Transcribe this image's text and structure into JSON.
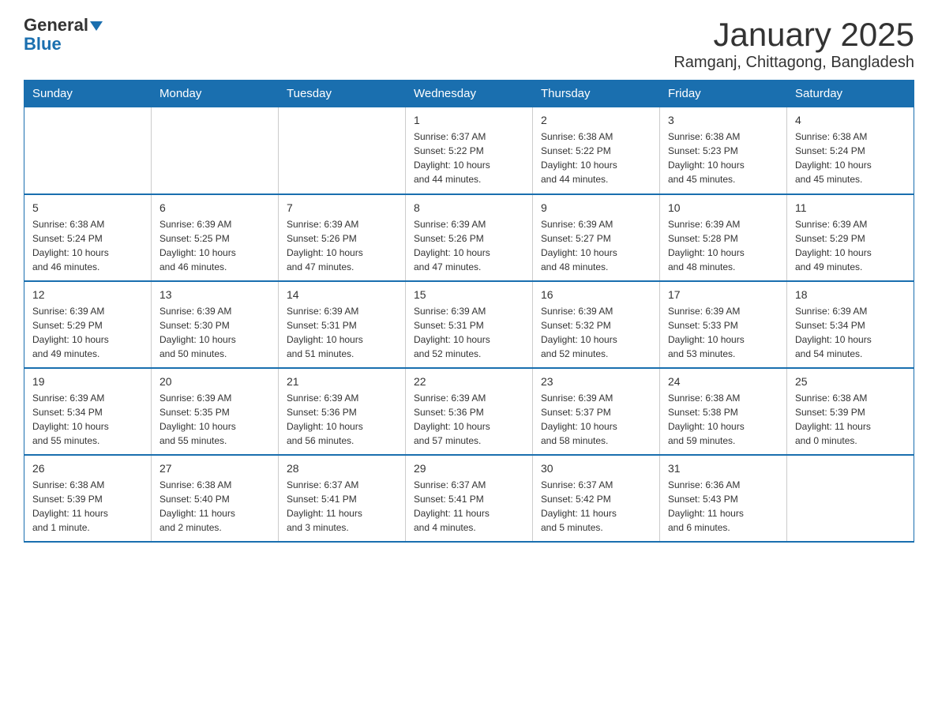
{
  "logo": {
    "line1": "General",
    "line2": "Blue"
  },
  "title": "January 2025",
  "subtitle": "Ramganj, Chittagong, Bangladesh",
  "weekdays": [
    "Sunday",
    "Monday",
    "Tuesday",
    "Wednesday",
    "Thursday",
    "Friday",
    "Saturday"
  ],
  "weeks": [
    [
      {
        "day": "",
        "info": ""
      },
      {
        "day": "",
        "info": ""
      },
      {
        "day": "",
        "info": ""
      },
      {
        "day": "1",
        "info": "Sunrise: 6:37 AM\nSunset: 5:22 PM\nDaylight: 10 hours\nand 44 minutes."
      },
      {
        "day": "2",
        "info": "Sunrise: 6:38 AM\nSunset: 5:22 PM\nDaylight: 10 hours\nand 44 minutes."
      },
      {
        "day": "3",
        "info": "Sunrise: 6:38 AM\nSunset: 5:23 PM\nDaylight: 10 hours\nand 45 minutes."
      },
      {
        "day": "4",
        "info": "Sunrise: 6:38 AM\nSunset: 5:24 PM\nDaylight: 10 hours\nand 45 minutes."
      }
    ],
    [
      {
        "day": "5",
        "info": "Sunrise: 6:38 AM\nSunset: 5:24 PM\nDaylight: 10 hours\nand 46 minutes."
      },
      {
        "day": "6",
        "info": "Sunrise: 6:39 AM\nSunset: 5:25 PM\nDaylight: 10 hours\nand 46 minutes."
      },
      {
        "day": "7",
        "info": "Sunrise: 6:39 AM\nSunset: 5:26 PM\nDaylight: 10 hours\nand 47 minutes."
      },
      {
        "day": "8",
        "info": "Sunrise: 6:39 AM\nSunset: 5:26 PM\nDaylight: 10 hours\nand 47 minutes."
      },
      {
        "day": "9",
        "info": "Sunrise: 6:39 AM\nSunset: 5:27 PM\nDaylight: 10 hours\nand 48 minutes."
      },
      {
        "day": "10",
        "info": "Sunrise: 6:39 AM\nSunset: 5:28 PM\nDaylight: 10 hours\nand 48 minutes."
      },
      {
        "day": "11",
        "info": "Sunrise: 6:39 AM\nSunset: 5:29 PM\nDaylight: 10 hours\nand 49 minutes."
      }
    ],
    [
      {
        "day": "12",
        "info": "Sunrise: 6:39 AM\nSunset: 5:29 PM\nDaylight: 10 hours\nand 49 minutes."
      },
      {
        "day": "13",
        "info": "Sunrise: 6:39 AM\nSunset: 5:30 PM\nDaylight: 10 hours\nand 50 minutes."
      },
      {
        "day": "14",
        "info": "Sunrise: 6:39 AM\nSunset: 5:31 PM\nDaylight: 10 hours\nand 51 minutes."
      },
      {
        "day": "15",
        "info": "Sunrise: 6:39 AM\nSunset: 5:31 PM\nDaylight: 10 hours\nand 52 minutes."
      },
      {
        "day": "16",
        "info": "Sunrise: 6:39 AM\nSunset: 5:32 PM\nDaylight: 10 hours\nand 52 minutes."
      },
      {
        "day": "17",
        "info": "Sunrise: 6:39 AM\nSunset: 5:33 PM\nDaylight: 10 hours\nand 53 minutes."
      },
      {
        "day": "18",
        "info": "Sunrise: 6:39 AM\nSunset: 5:34 PM\nDaylight: 10 hours\nand 54 minutes."
      }
    ],
    [
      {
        "day": "19",
        "info": "Sunrise: 6:39 AM\nSunset: 5:34 PM\nDaylight: 10 hours\nand 55 minutes."
      },
      {
        "day": "20",
        "info": "Sunrise: 6:39 AM\nSunset: 5:35 PM\nDaylight: 10 hours\nand 55 minutes."
      },
      {
        "day": "21",
        "info": "Sunrise: 6:39 AM\nSunset: 5:36 PM\nDaylight: 10 hours\nand 56 minutes."
      },
      {
        "day": "22",
        "info": "Sunrise: 6:39 AM\nSunset: 5:36 PM\nDaylight: 10 hours\nand 57 minutes."
      },
      {
        "day": "23",
        "info": "Sunrise: 6:39 AM\nSunset: 5:37 PM\nDaylight: 10 hours\nand 58 minutes."
      },
      {
        "day": "24",
        "info": "Sunrise: 6:38 AM\nSunset: 5:38 PM\nDaylight: 10 hours\nand 59 minutes."
      },
      {
        "day": "25",
        "info": "Sunrise: 6:38 AM\nSunset: 5:39 PM\nDaylight: 11 hours\nand 0 minutes."
      }
    ],
    [
      {
        "day": "26",
        "info": "Sunrise: 6:38 AM\nSunset: 5:39 PM\nDaylight: 11 hours\nand 1 minute."
      },
      {
        "day": "27",
        "info": "Sunrise: 6:38 AM\nSunset: 5:40 PM\nDaylight: 11 hours\nand 2 minutes."
      },
      {
        "day": "28",
        "info": "Sunrise: 6:37 AM\nSunset: 5:41 PM\nDaylight: 11 hours\nand 3 minutes."
      },
      {
        "day": "29",
        "info": "Sunrise: 6:37 AM\nSunset: 5:41 PM\nDaylight: 11 hours\nand 4 minutes."
      },
      {
        "day": "30",
        "info": "Sunrise: 6:37 AM\nSunset: 5:42 PM\nDaylight: 11 hours\nand 5 minutes."
      },
      {
        "day": "31",
        "info": "Sunrise: 6:36 AM\nSunset: 5:43 PM\nDaylight: 11 hours\nand 6 minutes."
      },
      {
        "day": "",
        "info": ""
      }
    ]
  ]
}
